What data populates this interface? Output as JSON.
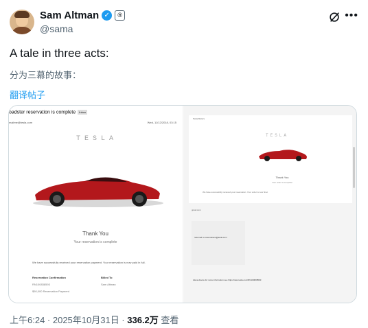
{
  "author": {
    "name": "Sam Altman",
    "handle": "@sama",
    "verified_icon": "verified-check-icon",
    "affiliation_badge": "®"
  },
  "header": {
    "more_icon": "•••"
  },
  "tweet": {
    "text": "A tale in three acts:",
    "translation": "分为三幕的故事：",
    "translate_link": "翻译帖子"
  },
  "media": {
    "left": {
      "subject": "oadster reservation is complete",
      "inbox_tag": "Inbox",
      "from": "mailme@tesla.com",
      "date": "Wed, 11/12/2018, 03:15",
      "logo": "TESLA",
      "thank_you": "Thank You",
      "thank_sub": "Your reservation is complete",
      "body": "We have successfully received your reservation payment. Your reservation is now paid in full.",
      "col1_head": "Reservation Confirmation",
      "col1_values": [
        "RN100838593",
        "$50,000 Reservation Payment"
      ],
      "col2_head": "Billed To",
      "col2_values": [
        "Sam Altman"
      ]
    },
    "right": {
      "sender": "Tesla Motors",
      "logo": "TESLA",
      "thank_you": "Thank You",
      "thank_sub": "Your order is complete",
      "body_line": "We have successfully received your reservation. Your order is now final.",
      "meta": "gmail.com",
      "dark_text": "returned to reservations@tesla.com",
      "log_line": "Alexa device for more information see https://aws.tesla.com/RN100838593"
    }
  },
  "footer": {
    "time": "上午6:24 · 2025年10月31日 · ",
    "views_count": "336.2万",
    "views_label": " 查看"
  },
  "colors": {
    "accent": "#1d9bf0",
    "car": "#b3181c"
  }
}
